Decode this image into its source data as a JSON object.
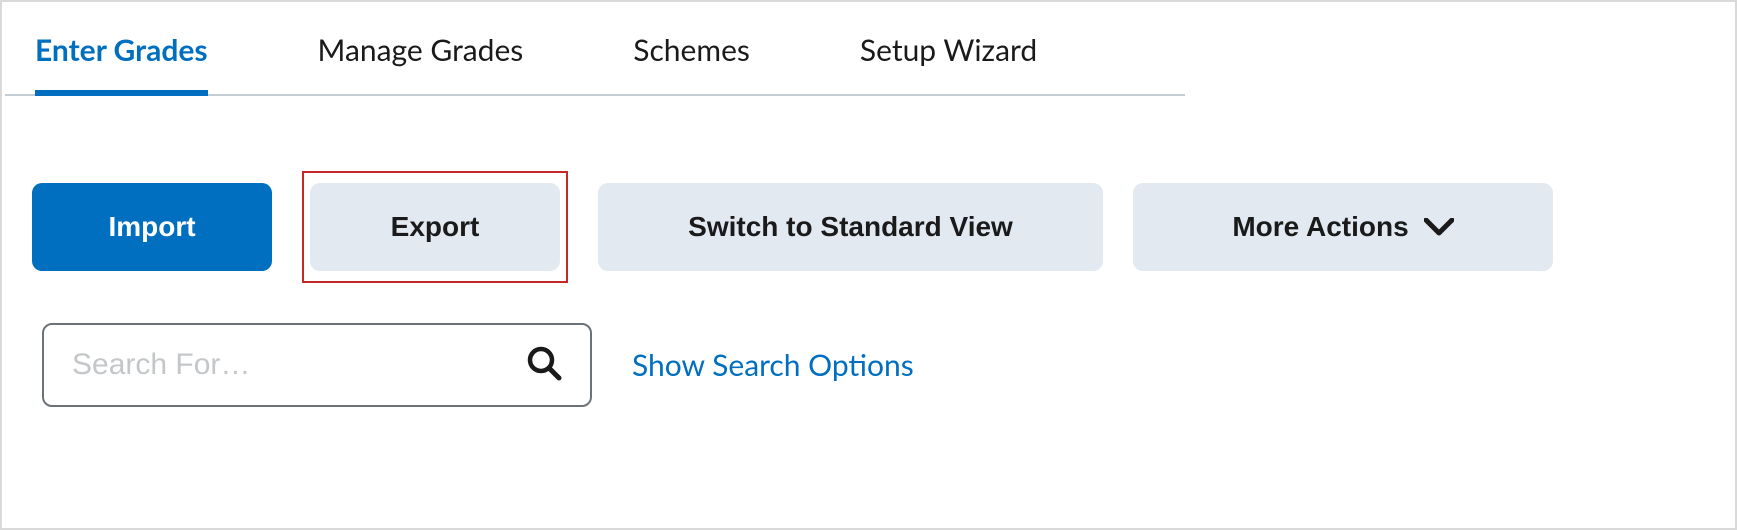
{
  "tabs": [
    {
      "label": "Enter Grades",
      "active": true
    },
    {
      "label": "Manage Grades",
      "active": false
    },
    {
      "label": "Schemes",
      "active": false
    },
    {
      "label": "Setup Wizard",
      "active": false
    }
  ],
  "toolbar": {
    "import_label": "Import",
    "export_label": "Export",
    "switch_view_label": "Switch to Standard View",
    "more_actions_label": "More Actions"
  },
  "search": {
    "placeholder": "Search For…",
    "value": "",
    "show_options_label": "Show Search Options"
  },
  "colors": {
    "primary": "#006fbf",
    "secondary_bg": "#e3e9f1",
    "highlight_border": "#c62828"
  }
}
